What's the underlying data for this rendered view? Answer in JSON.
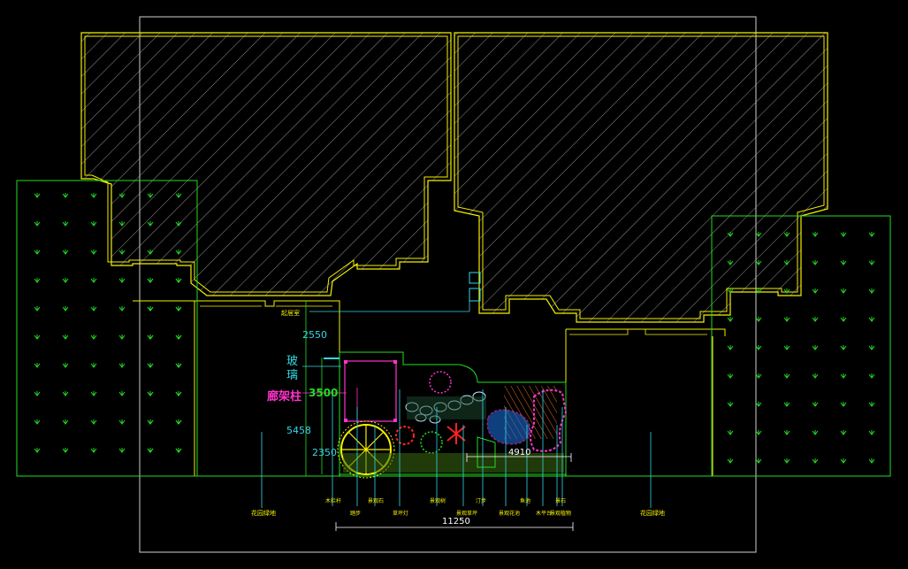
{
  "colors": {
    "background": "#000000",
    "building_outline": "#f5f000",
    "lawn_boundary": "#22dd22",
    "hatch": "#b8b8b8",
    "dimension": "#ffffff",
    "leader": "#35d7e6",
    "pergola": "#ff33cc",
    "paving": "#c85a1e"
  },
  "labels": {
    "glass_top": "玻",
    "glass_bottom": "璃",
    "pergola_column": "廊架柱",
    "entry_label": "起居室",
    "lawn_left_label": "花园绿地",
    "lawn_right_label": "花园绿地",
    "bottom_labels": [
      "木栏杆",
      "踏步",
      "景观石",
      "草坪灯",
      "景观树",
      "景观草坪",
      "汀步",
      "景观花池",
      "鱼池",
      "木平台",
      "景石",
      "景观植物"
    ]
  },
  "dimensions": {
    "d_2550": "2550",
    "d_3500": "3500",
    "d_5458": "5458",
    "d_2350": "2350",
    "d_4910": "4910",
    "d_total": "11250"
  }
}
